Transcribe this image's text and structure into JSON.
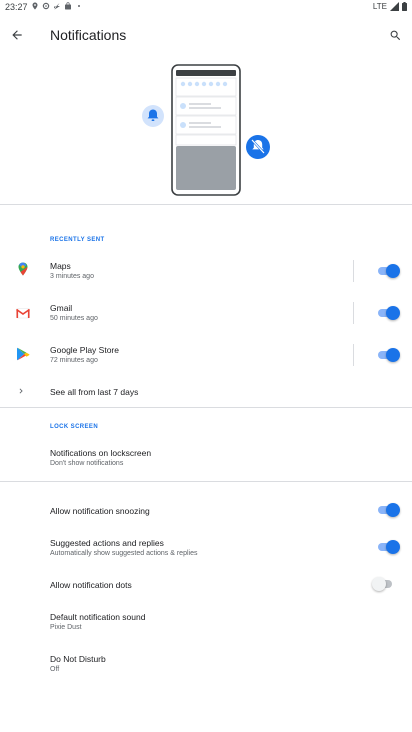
{
  "status_bar": {
    "time": "23:27",
    "network": "LTE"
  },
  "app_bar": {
    "title": "Notifications"
  },
  "recently_sent": {
    "header": "RECENTLY SENT",
    "apps": [
      {
        "name": "Maps",
        "time": "3 minutes ago",
        "enabled": true
      },
      {
        "name": "Gmail",
        "time": "50 minutes ago",
        "enabled": true
      },
      {
        "name": "Google Play Store",
        "time": "72 minutes ago",
        "enabled": true
      }
    ],
    "see_all": "See all from last 7 days"
  },
  "lock_screen": {
    "header": "LOCK SCREEN",
    "notifications_title": "Notifications on lockscreen",
    "notifications_value": "Don't show notifications"
  },
  "settings": {
    "snoozing": {
      "label": "Allow notification snoozing",
      "enabled": true
    },
    "suggested": {
      "label": "Suggested actions and replies",
      "sub": "Automatically show suggested actions & replies",
      "enabled": true
    },
    "dots": {
      "label": "Allow notification dots",
      "enabled": false
    },
    "sound": {
      "label": "Default notification sound",
      "value": "Pixie Dust"
    },
    "dnd": {
      "label": "Do Not Disturb",
      "value": "Off"
    }
  },
  "colors": {
    "accent": "#1a73e8",
    "accent_track": "#8ab4f8",
    "divider": "#dadce0"
  }
}
